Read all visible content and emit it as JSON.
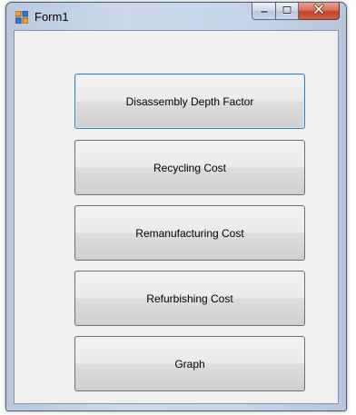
{
  "window": {
    "title": "Form1",
    "icon": "winforms-app-icon"
  },
  "caption": {
    "minimize_icon": "minimize-icon",
    "maximize_icon": "maximize-icon",
    "close_icon": "close-icon"
  },
  "buttons": [
    {
      "label": "Disassembly Depth Factor"
    },
    {
      "label": "Recycling Cost"
    },
    {
      "label": "Remanufacturing Cost"
    },
    {
      "label": "Refurbishing Cost"
    },
    {
      "label": "Graph"
    }
  ],
  "colors": {
    "title_bar": "#c7d4e8",
    "close_button": "#c2422a",
    "client_background": "#f0f0f0",
    "focus_border": "#3c7fb1"
  }
}
